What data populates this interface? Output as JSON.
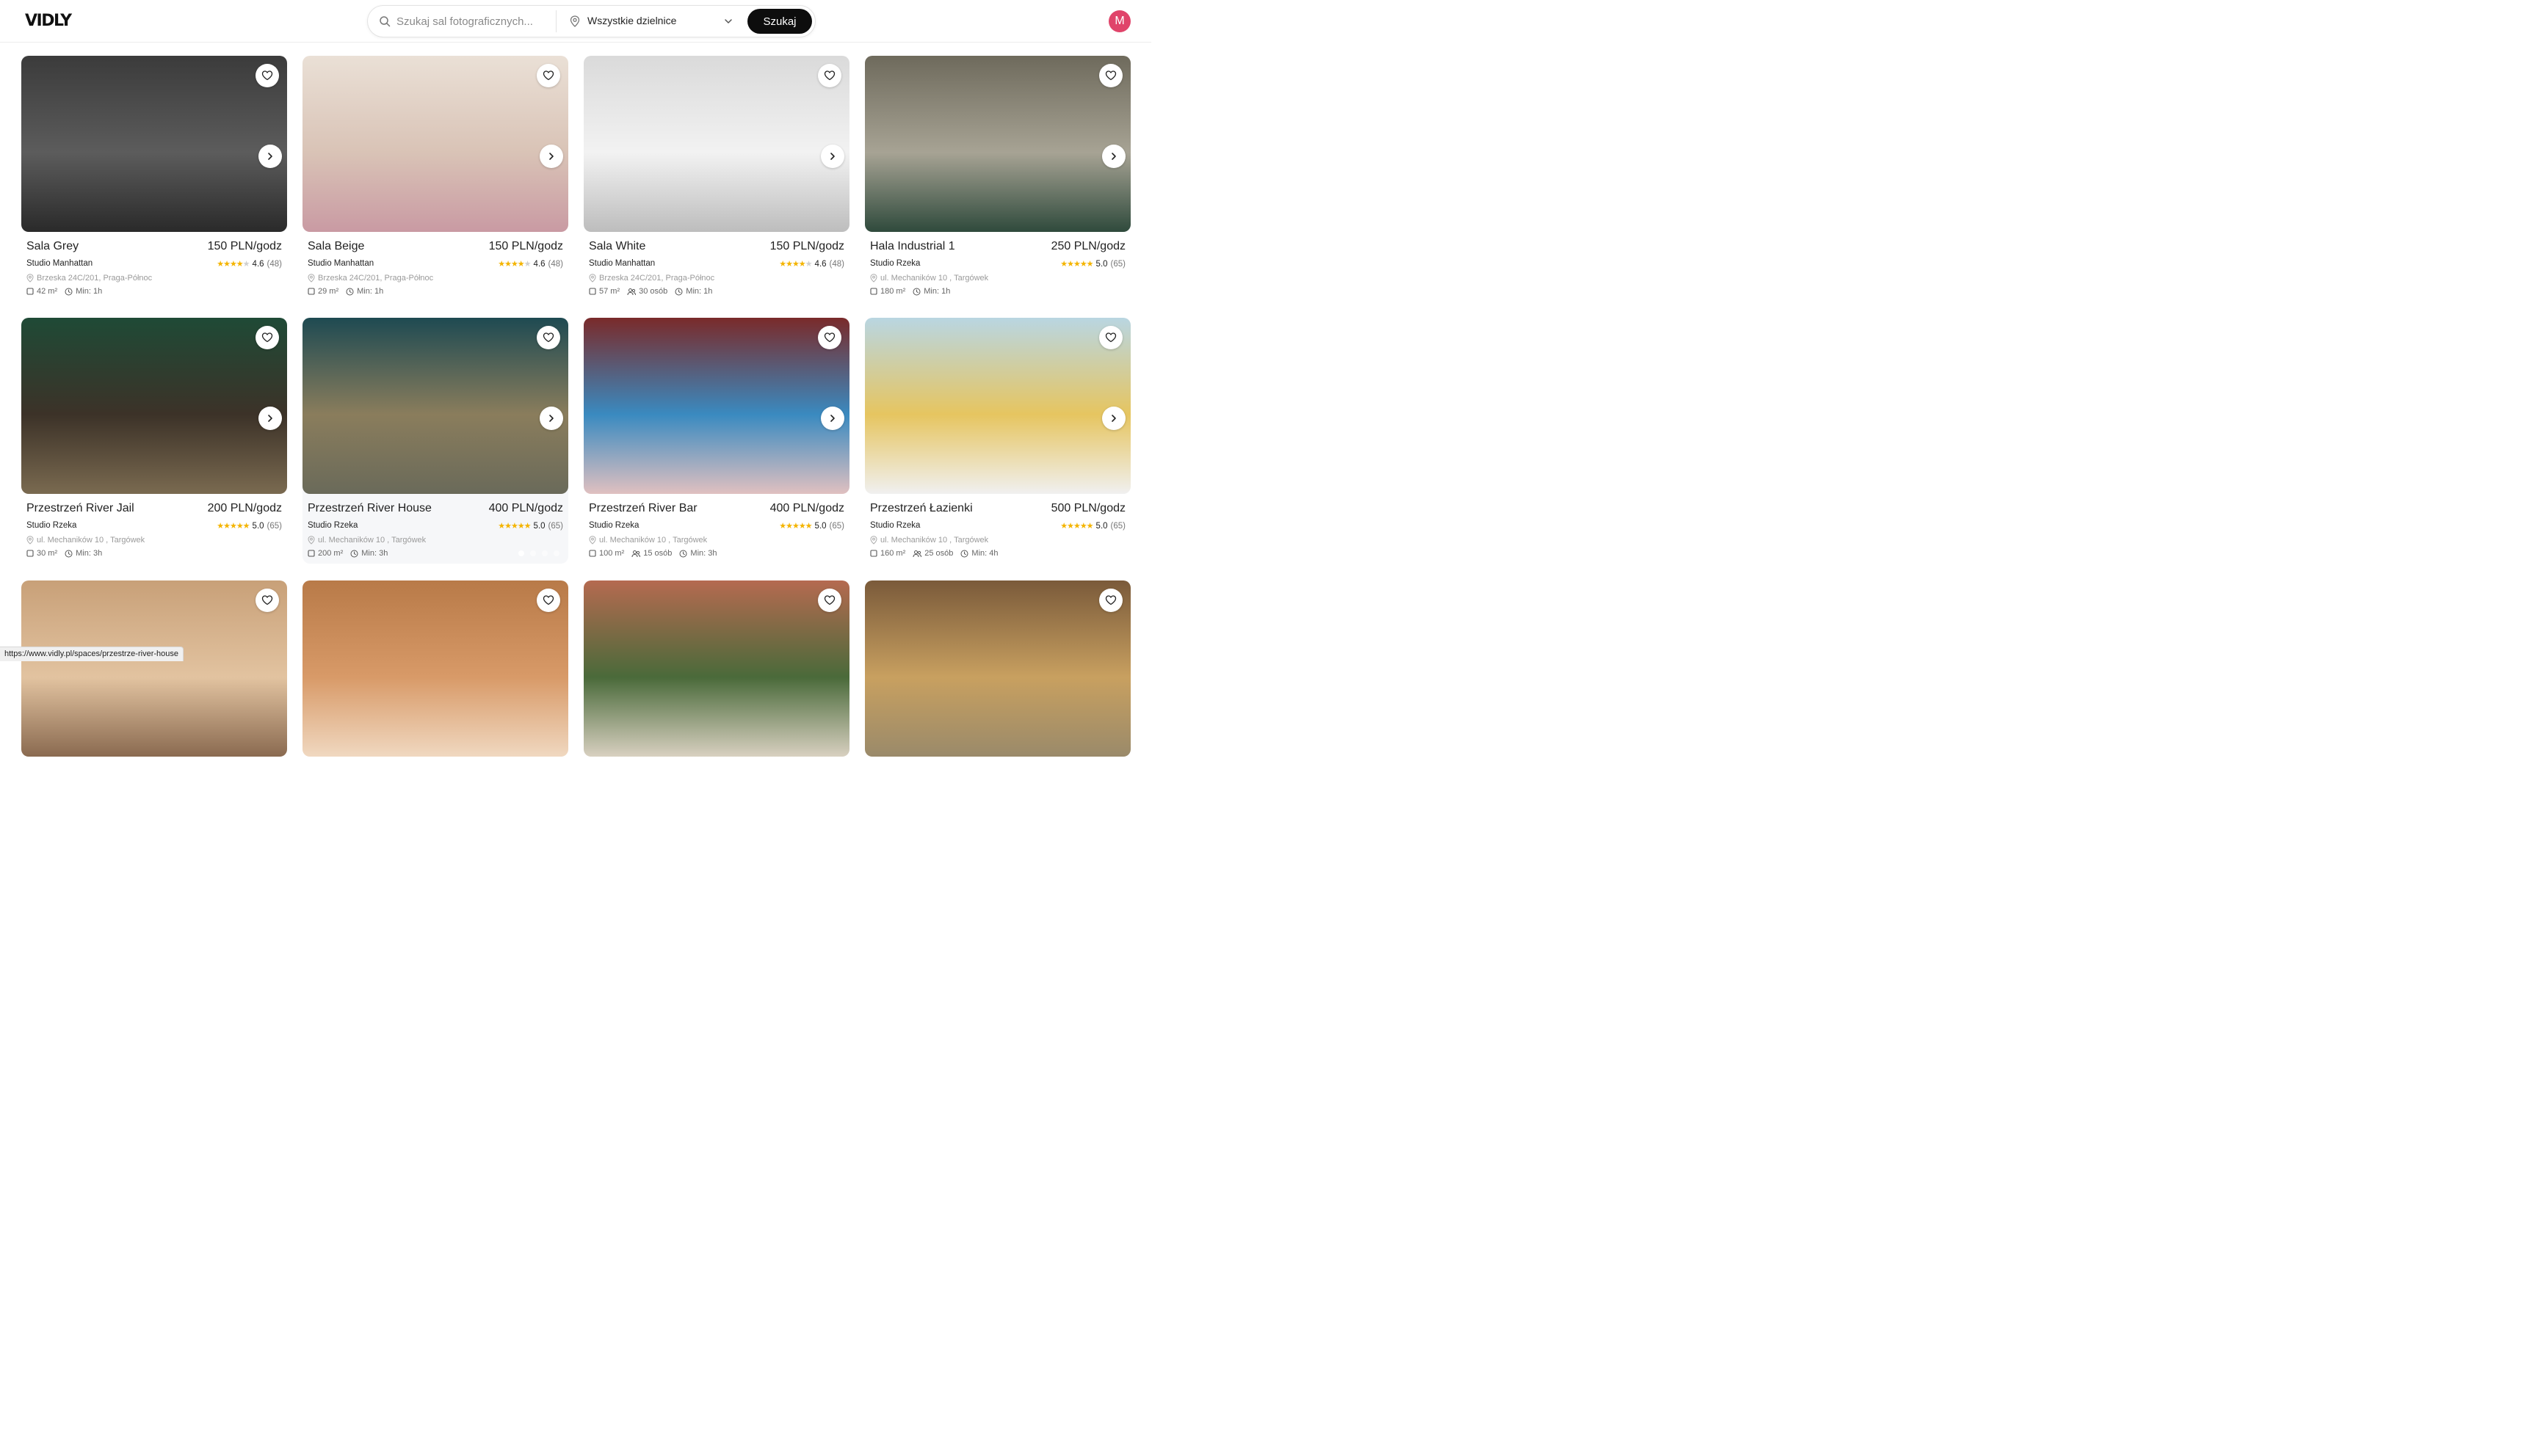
{
  "header": {
    "logo": "VIDLY",
    "search_placeholder": "Szukaj sal fotograficznych...",
    "district_value": "Wszystkie dzielnice",
    "search_button": "Szukaj",
    "avatar_letter": "M",
    "avatar_color": "#e0446a"
  },
  "listings": [
    {
      "title": "Sala Grey",
      "price": "150 PLN/godz",
      "studio": "Studio Manhattan",
      "rating_value": 4.6,
      "rating": "4.6",
      "reviews": "(48)",
      "address": "Brzeska 24C/201, Praga-Północ",
      "area": "42 m²",
      "capacity": "",
      "min": "Min: 1h",
      "photo_count": 4,
      "active_photo": 1,
      "palette": [
        "#3b3b3b",
        "#5c5c5c",
        "#2a2a2a"
      ]
    },
    {
      "title": "Sala Beige",
      "price": "150 PLN/godz",
      "studio": "Studio Manhattan",
      "rating_value": 4.6,
      "rating": "4.6",
      "reviews": "(48)",
      "address": "Brzeska 24C/201, Praga-Północ",
      "area": "29 m²",
      "capacity": "",
      "min": "Min: 1h",
      "photo_count": 4,
      "active_photo": 1,
      "palette": [
        "#eae0d6",
        "#d9c3b6",
        "#c99aa3"
      ]
    },
    {
      "title": "Sala White",
      "price": "150 PLN/godz",
      "studio": "Studio Manhattan",
      "rating_value": 4.6,
      "rating": "4.6",
      "reviews": "(48)",
      "address": "Brzeska 24C/201, Praga-Północ",
      "area": "57 m²",
      "capacity": "30 osób",
      "min": "Min: 1h",
      "photo_count": 4,
      "active_photo": 1,
      "palette": [
        "#dadada",
        "#f2f2f2",
        "#bdbdbd"
      ]
    },
    {
      "title": "Hala Industrial 1",
      "price": "250 PLN/godz",
      "studio": "Studio Rzeka",
      "rating_value": 5.0,
      "rating": "5.0",
      "reviews": "(65)",
      "address": "ul. Mechaników 10 , Targówek",
      "area": "180 m²",
      "capacity": "",
      "min": "Min: 1h",
      "photo_count": 4,
      "active_photo": 1,
      "palette": [
        "#6e6a5c",
        "#a7a394",
        "#2f4a3c"
      ]
    },
    {
      "title": "Przestrzeń River Jail",
      "price": "200 PLN/godz",
      "studio": "Studio Rzeka",
      "rating_value": 5.0,
      "rating": "5.0",
      "reviews": "(65)",
      "address": "ul. Mechaników 10 , Targówek",
      "area": "30 m²",
      "capacity": "",
      "min": "Min: 3h",
      "photo_count": 3,
      "active_photo": 1,
      "palette": [
        "#1f4a36",
        "#3c3228",
        "#7a6a50"
      ]
    },
    {
      "title": "Przestrzeń River House",
      "price": "400 PLN/godz",
      "studio": "Studio Rzeka",
      "rating_value": 5.0,
      "rating": "5.0",
      "reviews": "(65)",
      "address": "ul. Mechaników 10 , Targówek",
      "area": "200 m²",
      "capacity": "",
      "min": "Min: 3h",
      "photo_count": 4,
      "active_photo": 1,
      "palette": [
        "#1e4a52",
        "#8a7d5c",
        "#6a6a5a"
      ]
    },
    {
      "title": "Przestrzeń River Bar",
      "price": "400 PLN/godz",
      "studio": "Studio Rzeka",
      "rating_value": 5.0,
      "rating": "5.0",
      "reviews": "(65)",
      "address": "ul. Mechaników 10 , Targówek",
      "area": "100 m²",
      "capacity": "15 osób",
      "min": "Min: 3h",
      "photo_count": 4,
      "active_photo": 1,
      "palette": [
        "#7a2a2a",
        "#3a8ac0",
        "#e0c0c0"
      ]
    },
    {
      "title": "Przestrzeń Łazienki",
      "price": "500 PLN/godz",
      "studio": "Studio Rzeka",
      "rating_value": 5.0,
      "rating": "5.0",
      "reviews": "(65)",
      "address": "ul. Mechaników 10 , Targówek",
      "area": "160 m²",
      "capacity": "25 osób",
      "min": "Min: 4h",
      "photo_count": 4,
      "active_photo": 1,
      "palette": [
        "#b9d6e2",
        "#e6c560",
        "#f0f0f0"
      ]
    },
    {
      "palette": [
        "#c8a078",
        "#e2c3a0",
        "#8a6a50"
      ]
    },
    {
      "palette": [
        "#b87a48",
        "#d89a68",
        "#f0d8c0"
      ]
    },
    {
      "palette": [
        "#b56a50",
        "#4a6a3a",
        "#d8d0c0"
      ]
    },
    {
      "palette": [
        "#7a5a3a",
        "#c8a060",
        "#9a8a6a"
      ]
    }
  ],
  "status_bar_url": "https://www.vidly.pl/spaces/przestrze-river-house"
}
